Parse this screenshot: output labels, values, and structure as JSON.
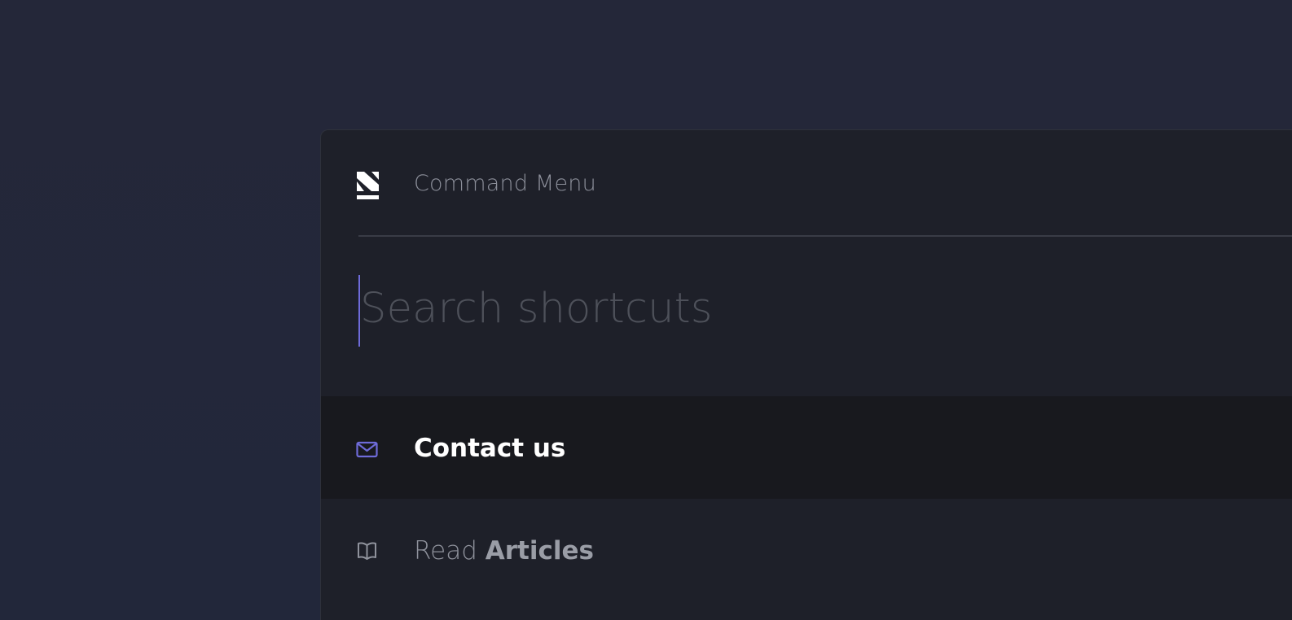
{
  "colors": {
    "background": "#232738",
    "panel": "#1e2029",
    "active_row": "#18191e",
    "accent": "#6e6bd8",
    "muted_text": "#8c8f9a"
  },
  "header": {
    "title": "Command Menu",
    "logo_icon": "brand-logo-icon"
  },
  "search": {
    "placeholder": "Search shortcuts",
    "value": ""
  },
  "items": [
    {
      "icon": "mail-icon",
      "label": "Contact us",
      "active": true
    },
    {
      "icon": "book-icon",
      "label_prefix": "Read",
      "label_bold": "Articles",
      "active": false
    }
  ]
}
